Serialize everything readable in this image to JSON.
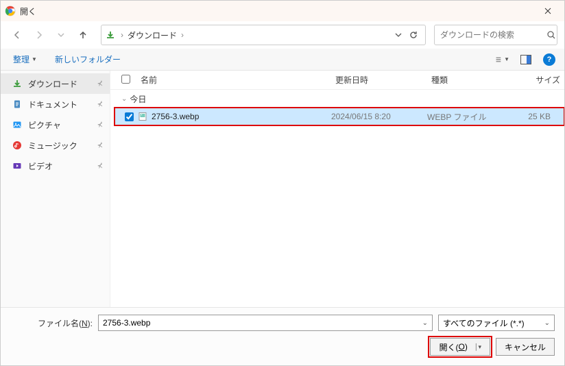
{
  "titlebar": {
    "title": "開く"
  },
  "nav": {
    "path_location": "ダウンロード",
    "search_placeholder": "ダウンロードの検索"
  },
  "toolbar": {
    "organize": "整理",
    "new_folder": "新しいフォルダー"
  },
  "sidebar": {
    "items": [
      {
        "label": "ダウンロード",
        "icon": "download",
        "selected": true
      },
      {
        "label": "ドキュメント",
        "icon": "document",
        "selected": false
      },
      {
        "label": "ピクチャ",
        "icon": "pictures",
        "selected": false
      },
      {
        "label": "ミュージック",
        "icon": "music",
        "selected": false
      },
      {
        "label": "ビデオ",
        "icon": "video",
        "selected": false
      }
    ]
  },
  "columns": {
    "name": "名前",
    "date": "更新日時",
    "type": "種類",
    "size": "サイズ"
  },
  "groups": [
    {
      "label": "今日",
      "files": [
        {
          "name": "2756-3.webp",
          "date": "2024/06/15 8:20",
          "type": "WEBP ファイル",
          "size": "25 KB",
          "selected": true,
          "checked": true
        }
      ]
    }
  ],
  "footer": {
    "filename_label": "ファイル名(",
    "filename_accel": "N",
    "filename_label_after": "):",
    "filename_value": "2756-3.webp",
    "filter_value": "すべてのファイル (*.*)",
    "open_label": "開く(",
    "open_accel": "O",
    "open_label_after": ")",
    "cancel_label": "キャンセル"
  }
}
